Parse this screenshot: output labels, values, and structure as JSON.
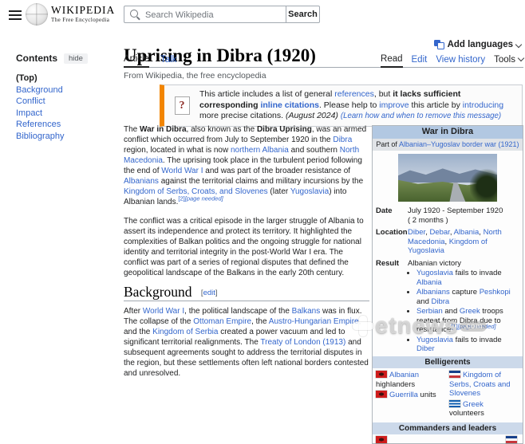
{
  "colors": {
    "link_blue": "#3366cc",
    "ambox_orange": "#f28500",
    "infobox_header": "#b2c8e2",
    "infobox_section_header": "#ccd9ea",
    "border_gray": "#a2a9b1"
  },
  "icons": {
    "menu": "hamburger-menu-icon",
    "logo": "wikipedia-globe-icon",
    "search": "magnifier-icon",
    "language": "translate-icon",
    "chevron": "chevron-down-icon",
    "notice": "question-mark-icon",
    "flags": [
      "albanian-flag",
      "yugoslav-flag",
      "greek-flag"
    ]
  },
  "header": {
    "wordmark": "WIKIPEDIA",
    "wordmark_sub": "The Free Encyclopedia",
    "search_placeholder": "Search Wikipedia",
    "search_button": "Search"
  },
  "sidebar": {
    "contents_label": "Contents",
    "hide_button": "hide",
    "items": [
      {
        "label": "(Top)"
      },
      {
        "label": "Background"
      },
      {
        "label": "Conflict"
      },
      {
        "label": "Impact"
      },
      {
        "label": "References"
      },
      {
        "label": "Bibliography"
      }
    ]
  },
  "page": {
    "title": "Uprising in Dibra (1920)",
    "add_languages_label": "Add languages",
    "tagline": "From Wikipedia, the free encyclopedia",
    "tab_article": "Article",
    "tab_talk": "Talk",
    "menu_read": "Read",
    "menu_edit": "Edit",
    "menu_view_history": "View history",
    "menu_tools": "Tools"
  },
  "notice": {
    "icon_glyph": "?",
    "segments": [
      {
        "t": "This article includes a list of general ",
        "k": "p"
      },
      {
        "t": "references",
        "k": "l"
      },
      {
        "t": ", but ",
        "k": "p"
      },
      {
        "t": "it lacks sufficient corresponding ",
        "k": "b"
      },
      {
        "t": "inline citations",
        "k": "bl"
      },
      {
        "t": ". Please help to ",
        "k": "p"
      },
      {
        "t": "improve",
        "k": "l"
      },
      {
        "t": " this article by ",
        "k": "p"
      },
      {
        "t": "introducing",
        "k": "l"
      },
      {
        "t": " more precise citations. ",
        "k": "p"
      },
      {
        "t": "(August 2024)",
        "k": "i"
      },
      {
        "t": " ",
        "k": "p"
      },
      {
        "t": "(Learn how and when to remove this message)",
        "k": "il"
      }
    ]
  },
  "article": {
    "p1": [
      {
        "t": "The ",
        "k": "p"
      },
      {
        "t": "War in Dibra",
        "k": "b"
      },
      {
        "t": ", also known as the ",
        "k": "p"
      },
      {
        "t": "Dibra Uprising",
        "k": "b"
      },
      {
        "t": ", was an armed conflict which occurred from July to September 1920 in the ",
        "k": "p"
      },
      {
        "t": "Dibra",
        "k": "l"
      },
      {
        "t": " region, located in what is now ",
        "k": "p"
      },
      {
        "t": "northern Albania",
        "k": "l"
      },
      {
        "t": " and southern ",
        "k": "p"
      },
      {
        "t": "North Macedonia",
        "k": "l"
      },
      {
        "t": ". The uprising took place in the turbulent period following the end of ",
        "k": "p"
      },
      {
        "t": "World War I",
        "k": "l"
      },
      {
        "t": " and was part of the broader resistance of ",
        "k": "p"
      },
      {
        "t": "Albanians",
        "k": "l"
      },
      {
        "t": " against the territorial claims and military incursions by the ",
        "k": "p"
      },
      {
        "t": "Kingdom of Serbs, Croats, and Slovenes",
        "k": "l"
      },
      {
        "t": " (later ",
        "k": "p"
      },
      {
        "t": "Yugoslavia",
        "k": "l"
      },
      {
        "t": ") into Albanian lands.",
        "k": "p"
      },
      {
        "t": "[2]",
        "k": "s"
      },
      {
        "t": "[page needed]",
        "k": "si"
      }
    ],
    "p2": [
      {
        "t": "The conflict was a critical episode in the larger struggle of Albania to assert its independence and protect its territory. It highlighted the complexities of Balkan politics and the ongoing struggle for national identity and territorial integrity in the post-World War I era. The conflict was part of a series of regional disputes that defined the geopolitical landscape of the Balkans in the early 20th century.",
        "k": "p"
      }
    ],
    "background_heading": "Background",
    "edit_link": [
      {
        "t": "[",
        "k": "g"
      },
      {
        "t": "edit",
        "k": "l"
      },
      {
        "t": "]",
        "k": "g"
      }
    ],
    "p3": [
      {
        "t": "After ",
        "k": "p"
      },
      {
        "t": "World War I",
        "k": "l"
      },
      {
        "t": ", the political landscape of the ",
        "k": "p"
      },
      {
        "t": "Balkans",
        "k": "l"
      },
      {
        "t": " was in flux. The collapse of the ",
        "k": "p"
      },
      {
        "t": "Ottoman Empire",
        "k": "l"
      },
      {
        "t": ", the ",
        "k": "p"
      },
      {
        "t": "Austro-Hungarian Empire",
        "k": "l"
      },
      {
        "t": ", and the ",
        "k": "p"
      },
      {
        "t": "Kingdom of Serbia",
        "k": "l"
      },
      {
        "t": " created a power vacuum and led to significant territorial realignments. The ",
        "k": "p"
      },
      {
        "t": "Treaty of London (1913)",
        "k": "l"
      },
      {
        "t": " and subsequent agreements sought to address the territorial disputes in the region, but these settlements often left national borders contested and unresolved.",
        "k": "p"
      }
    ]
  },
  "infobox": {
    "title": "War in Dibra",
    "partof": [
      {
        "t": "Part of ",
        "k": "p"
      },
      {
        "t": "Albanian–Yugoslav border war (1921)",
        "k": "l"
      }
    ],
    "rows": {
      "date_label": "Date",
      "date_value": [
        {
          "t": "July 1920 - September 1920",
          "k": "p"
        },
        {
          "k": "br"
        },
        {
          "t": "( 2 months )",
          "k": "p"
        }
      ],
      "location_label": "Location",
      "location_value": [
        {
          "t": "Diber",
          "k": "l"
        },
        {
          "t": ", ",
          "k": "p"
        },
        {
          "t": "Debar",
          "k": "l"
        },
        {
          "t": ", ",
          "k": "p"
        },
        {
          "t": "Albania",
          "k": "l"
        },
        {
          "t": ", ",
          "k": "p"
        },
        {
          "t": "North Macedonia",
          "k": "l"
        },
        {
          "t": ", ",
          "k": "p"
        },
        {
          "t": "Kingdom of Yugoslavia",
          "k": "l"
        }
      ],
      "result_label": "Result",
      "result_value": [
        {
          "t": "Albanian victory",
          "k": "p"
        }
      ],
      "result_bullets": [
        [
          {
            "t": "Yugoslavia",
            "k": "l"
          },
          {
            "t": " fails to invade ",
            "k": "p"
          },
          {
            "t": "Albania",
            "k": "l"
          }
        ],
        [
          {
            "t": "Albanians",
            "k": "l"
          },
          {
            "t": " capture ",
            "k": "p"
          },
          {
            "t": "Peshkopi",
            "k": "l"
          },
          {
            "t": " and ",
            "k": "p"
          },
          {
            "t": "Dibra",
            "k": "l"
          }
        ],
        [
          {
            "t": "Serbian",
            "k": "l"
          },
          {
            "t": " and ",
            "k": "p"
          },
          {
            "t": "Greek",
            "k": "l"
          },
          {
            "t": " troops reateat from Dibra due to resistance",
            "k": "p"
          },
          {
            "t": "[1]",
            "k": "s"
          },
          {
            "t": "[page needed]",
            "k": "si"
          }
        ],
        [
          {
            "t": "Yugoslavia",
            "k": "l"
          },
          {
            "t": " fails to invade ",
            "k": "p"
          },
          {
            "t": "Diber",
            "k": "l"
          }
        ]
      ]
    },
    "belligerents_header": "Belligerents",
    "belligerents_left": [
      [
        {
          "t": "Albanian",
          "k": "l"
        },
        {
          "t": " highlanders",
          "k": "p"
        }
      ],
      [
        {
          "t": "Guerrilla",
          "k": "l"
        },
        {
          "t": " units",
          "k": "p"
        }
      ]
    ],
    "belligerents_right": [
      [
        {
          "t": "Kingdom of Serbs, Croats and Slovenes",
          "k": "l"
        }
      ],
      [
        {
          "t": "Greek",
          "k": "l"
        },
        {
          "t": " volunteers",
          "k": "p"
        }
      ]
    ],
    "commanders_header": "Commanders and leaders"
  },
  "watermark": {
    "text": "etnews",
    "tld": ".com"
  }
}
